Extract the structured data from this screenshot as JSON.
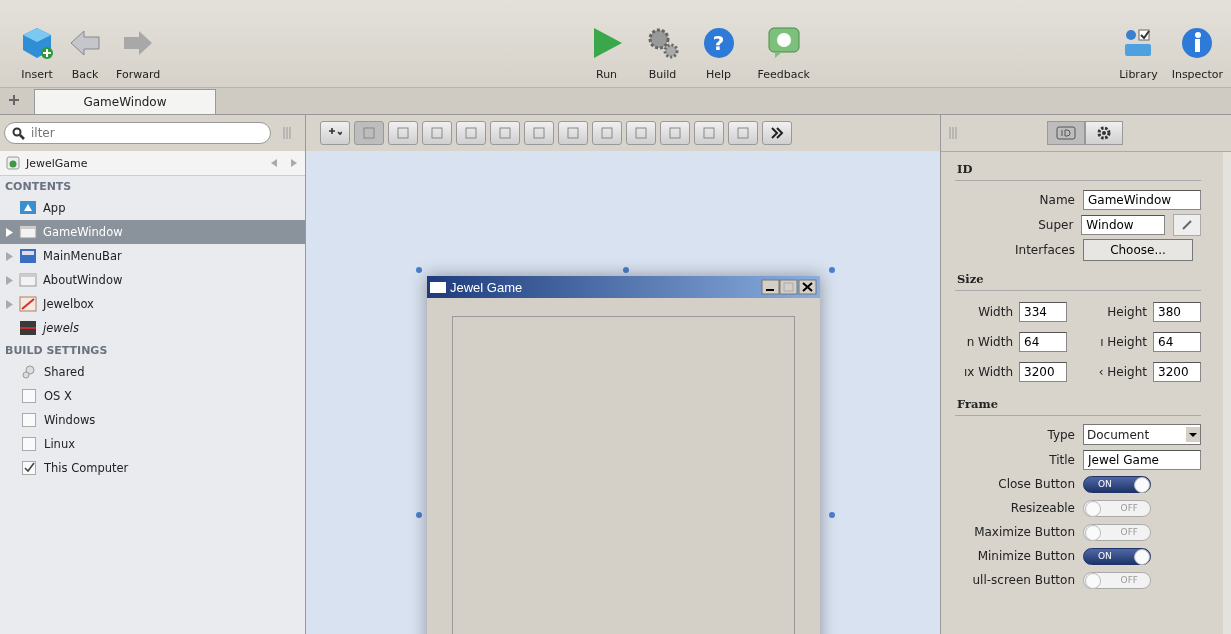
{
  "toolbar": {
    "left": [
      {
        "kind": "insert",
        "label": "Insert"
      },
      {
        "kind": "back",
        "label": "Back"
      },
      {
        "kind": "forward",
        "label": "Forward"
      }
    ],
    "center": [
      {
        "kind": "run",
        "label": "Run"
      },
      {
        "kind": "build",
        "label": "Build"
      },
      {
        "kind": "help",
        "label": "Help",
        "glyph": "?"
      },
      {
        "kind": "feedback",
        "label": "Feedback"
      }
    ],
    "right": [
      {
        "kind": "library",
        "label": "Library"
      },
      {
        "kind": "inspector",
        "label": "Inspector"
      }
    ]
  },
  "tabs": [
    {
      "label": "GameWindow",
      "selected": true
    }
  ],
  "search": {
    "placeholder": "ilter"
  },
  "navigator": {
    "project": "JewelGame",
    "contents_heading": "CONTENTS",
    "contents": [
      {
        "label": "App",
        "kind": "app",
        "expandable": false,
        "selected": false,
        "italic": false
      },
      {
        "label": "GameWindow",
        "kind": "window",
        "expandable": true,
        "selected": true,
        "italic": false
      },
      {
        "label": "MainMenuBar",
        "kind": "menubar",
        "expandable": true,
        "selected": false,
        "italic": false
      },
      {
        "label": "AboutWindow",
        "kind": "window",
        "expandable": true,
        "selected": false,
        "italic": false
      },
      {
        "label": "Jewelbox",
        "kind": "canvas",
        "expandable": true,
        "selected": false,
        "italic": false
      },
      {
        "label": "jewels",
        "kind": "picture",
        "expandable": false,
        "selected": false,
        "italic": true
      }
    ],
    "build_heading": "BUILD SETTINGS",
    "build": [
      {
        "kind": "shared",
        "label": "Shared"
      },
      {
        "kind": "check",
        "label": "OS X",
        "checked": false
      },
      {
        "kind": "check",
        "label": "Windows",
        "checked": false
      },
      {
        "kind": "check",
        "label": "Linux",
        "checked": false
      },
      {
        "kind": "check",
        "label": "This Computer",
        "checked": true
      }
    ]
  },
  "editor": {
    "window_title": "Jewel Game"
  },
  "inspector": {
    "tabs": [
      {
        "kind": "id",
        "selected": true
      },
      {
        "kind": "gear",
        "selected": false
      }
    ],
    "id": {
      "heading": "ID",
      "name_label": "Name",
      "name": "GameWindow",
      "super_label": "Super",
      "super": "Window",
      "interfaces_label": "Interfaces",
      "interfaces_button": "Choose..."
    },
    "size": {
      "heading": "Size",
      "rows": [
        {
          "l1": "Width",
          "v1": "334",
          "l2": "Height",
          "v2": "380"
        },
        {
          "l1": "n Width",
          "v1": "64",
          "l2": "ı Height",
          "v2": "64"
        },
        {
          "l1": "ıx Width",
          "v1": "3200",
          "l2": "‹ Height",
          "v2": "3200"
        }
      ]
    },
    "frame": {
      "heading": "Frame",
      "type_label": "Type",
      "type": "Document",
      "title_label": "Title",
      "title": "Jewel Game",
      "switches": [
        {
          "label": "Close Button",
          "on": true,
          "text": "ON"
        },
        {
          "label": "Resizeable",
          "on": false,
          "text": "OFF"
        },
        {
          "label": "Maximize Button",
          "on": false,
          "text": "OFF"
        },
        {
          "label": "Minimize Button",
          "on": true,
          "text": "ON"
        },
        {
          "label": "ull-screen Button",
          "on": false,
          "text": "OFF"
        }
      ]
    }
  }
}
